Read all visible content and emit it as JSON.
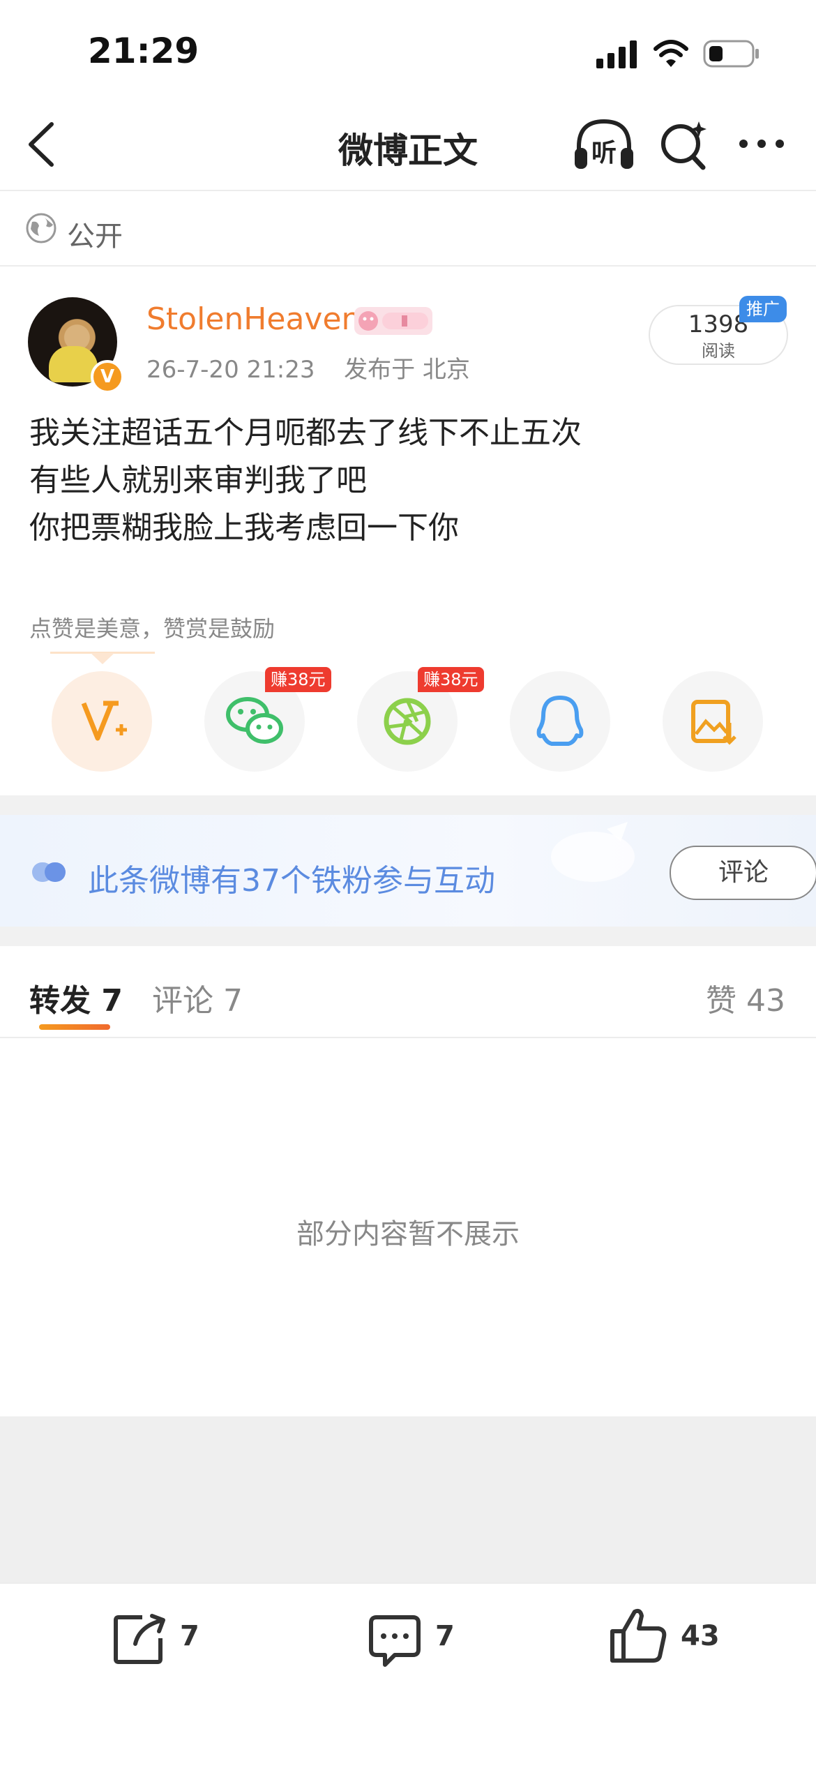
{
  "status_bar": {
    "time": "21:29"
  },
  "nav": {
    "title": "微博正文",
    "listen_label": "听"
  },
  "visibility": {
    "label": "公开"
  },
  "post": {
    "username": "StolenHeaven",
    "timestamp": "26-7-20 21:23",
    "location": "发布于 北京",
    "read_count": "1398",
    "read_label": "阅读",
    "promo_badge": "推广",
    "content_lines": [
      "我关注超话五个月呃都去了线下不止五次",
      "有些人就别来审判我了吧",
      "你把票糊我脸上我考虑回一下你"
    ],
    "reward_hint": "点赞是美意，赞赏是鼓励"
  },
  "share": {
    "earn_badges": [
      "赚38元",
      "赚38元"
    ],
    "colors": {
      "vplus": "#f59a1f",
      "wechat": "#3fbf6a",
      "moments": "#8cd04b",
      "qq": "#4a9ef0",
      "save": "#f0a020"
    }
  },
  "fan_bar": {
    "text": "此条微博有37个铁粉参与互动",
    "button": "评论"
  },
  "tabs": {
    "repost": "转发 7",
    "comment": "评论 7",
    "like": "赞 43"
  },
  "hidden_note": "部分内容暂不展示",
  "bottom_bar": {
    "repost_count": "7",
    "comment_count": "7",
    "like_count": "43"
  },
  "colors": {
    "accent": "#f07c2e",
    "link_blue": "#5b8be0",
    "earn_red": "#ee3b2f"
  }
}
